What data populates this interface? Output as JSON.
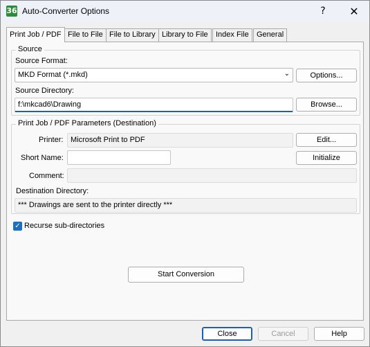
{
  "window": {
    "title": "Auto-Converter Options",
    "icon_text": "36",
    "help_glyph": "?",
    "close_glyph": "✕"
  },
  "tabs": [
    {
      "label": "Print Job / PDF",
      "active": true
    },
    {
      "label": "File to File"
    },
    {
      "label": "File to Library"
    },
    {
      "label": "Library to File"
    },
    {
      "label": "Index File"
    },
    {
      "label": "General"
    }
  ],
  "source": {
    "group_label": "Source",
    "format_label": "Source Format:",
    "format_value": "MKD Format (*.mkd)",
    "options_button": "Options...",
    "directory_label": "Source Directory:",
    "directory_value": "f:\\mkcad6\\Drawing",
    "browse_button": "Browse..."
  },
  "destination": {
    "group_label": "Print Job / PDF Parameters (Destination)",
    "printer_label": "Printer:",
    "printer_value": "Microsoft Print to PDF",
    "edit_button": "Edit...",
    "short_name_label": "Short Name:",
    "short_name_value": "",
    "initialize_button": "Initialize",
    "comment_label": "Comment:",
    "comment_value": "",
    "dest_dir_label": "Destination Directory:",
    "dest_dir_value": "*** Drawings are sent to the printer directly ***"
  },
  "recurse": {
    "label": "Recurse sub-directories",
    "checked": true
  },
  "start_button": "Start Conversion",
  "footer": {
    "close": "Close",
    "cancel": "Cancel",
    "help": "Help"
  }
}
